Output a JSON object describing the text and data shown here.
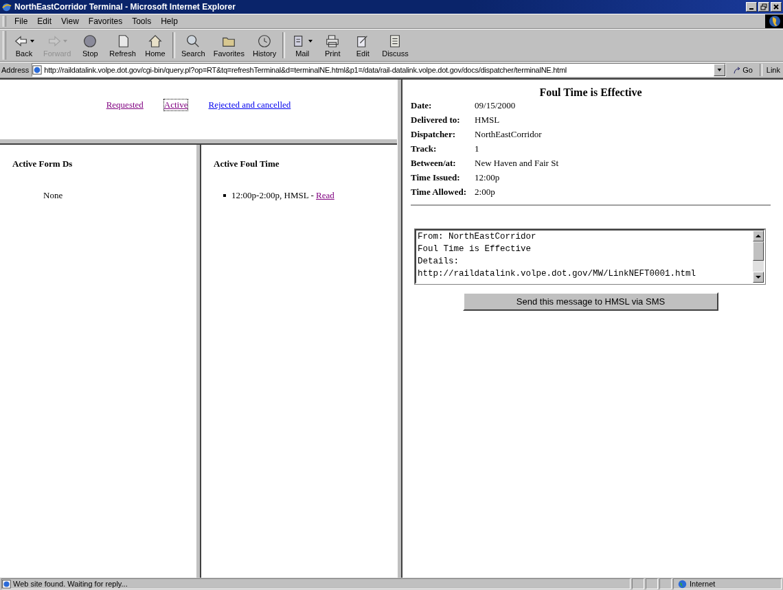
{
  "window": {
    "title": "NorthEastCorridor Terminal - Microsoft Internet Explorer"
  },
  "menu": [
    "File",
    "Edit",
    "View",
    "Favorites",
    "Tools",
    "Help"
  ],
  "toolbar": [
    {
      "kind": "back",
      "label": "Back",
      "disabled": false,
      "dropdown": true
    },
    {
      "kind": "forward",
      "label": "Forward",
      "disabled": true,
      "dropdown": true
    },
    {
      "kind": "stop",
      "label": "Stop",
      "disabled": false,
      "dropdown": false
    },
    {
      "kind": "refresh",
      "label": "Refresh",
      "disabled": false,
      "dropdown": false
    },
    {
      "kind": "home",
      "label": "Home",
      "disabled": false,
      "dropdown": false
    },
    {
      "kind": "search",
      "label": "Search",
      "disabled": false,
      "dropdown": false
    },
    {
      "kind": "favorites",
      "label": "Favorites",
      "disabled": false,
      "dropdown": false
    },
    {
      "kind": "history",
      "label": "History",
      "disabled": false,
      "dropdown": false
    },
    {
      "kind": "mail",
      "label": "Mail",
      "disabled": false,
      "dropdown": true
    },
    {
      "kind": "print",
      "label": "Print",
      "disabled": false,
      "dropdown": false
    },
    {
      "kind": "edit",
      "label": "Edit",
      "disabled": false,
      "dropdown": false
    },
    {
      "kind": "discuss",
      "label": "Discuss",
      "disabled": false,
      "dropdown": false
    }
  ],
  "address_bar": {
    "label": "Address",
    "value": "http://raildatalink.volpe.dot.gov/cgi-bin/query.pl?op=RT&tq=refreshTerminal&d=terminalNE.html&p1=/data/rail-datalink.volpe.dot.gov/docs/dispatcher/terminalNE.html",
    "go": "Go",
    "links": "Link"
  },
  "nav_links": [
    {
      "label": "Requested",
      "visited": true,
      "selected": false
    },
    {
      "label": "Active",
      "visited": true,
      "selected": true
    },
    {
      "label": "Rejected and cancelled",
      "visited": false,
      "selected": false
    }
  ],
  "form_ds": {
    "heading": "Active Form Ds",
    "empty_text": "None"
  },
  "foul_time": {
    "heading": "Active Foul Time",
    "items": [
      {
        "text": "12:00p-2:00p, HMSL - ",
        "link": "Read"
      }
    ]
  },
  "detail": {
    "title": "Foul Time is Effective",
    "fields": [
      {
        "label": "Date:",
        "value": "09/15/2000"
      },
      {
        "label": "Delivered to:",
        "value": "HMSL"
      },
      {
        "label": "Dispatcher:",
        "value": "NorthEastCorridor"
      },
      {
        "label": "Track:",
        "value": "1"
      },
      {
        "label": "Between/at:",
        "value": "New Haven and Fair St"
      },
      {
        "label": "Time Issued:",
        "value": "12:00p"
      },
      {
        "label": "Time Allowed:",
        "value": "2:00p"
      }
    ],
    "message": "From: NorthEastCorridor\nFoul Time is Effective\nDetails:\nhttp://raildatalink.volpe.dot.gov/MW/LinkNEFT0001.html",
    "send_button": "Send this message to HMSL via SMS"
  },
  "status_bar": {
    "text": "Web site found. Waiting for reply...",
    "zone": "Internet"
  }
}
